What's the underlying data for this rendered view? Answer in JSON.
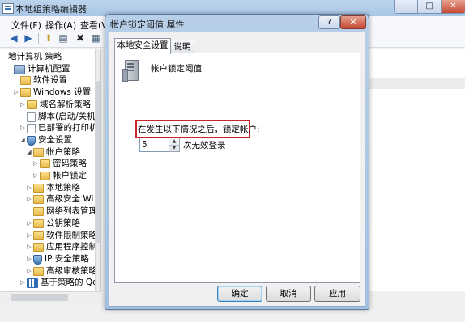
{
  "main_window": {
    "title": "本地组策略编辑器",
    "menu": [
      "文件(F)",
      "操作(A)",
      "查看(V)"
    ],
    "caption": {
      "minimize": "–",
      "maximize": "□",
      "close": "✕"
    }
  },
  "toolbar": {
    "back_icon": "back-arrow-icon",
    "forward_icon": "forward-arrow-icon",
    "back": "◀",
    "forward": "▶",
    "up": "⬆",
    "show_hide": "▤",
    "delete": "✖",
    "properties": "▦"
  },
  "tree": {
    "items": [
      {
        "label": "地计算机 策略",
        "expander": "",
        "icon": "none"
      },
      {
        "label": "计算机配置",
        "expander": "",
        "icon": "pc"
      },
      {
        "label": "软件设置",
        "expander": "",
        "icon": "folder"
      },
      {
        "label": "Windows 设置",
        "expander": "▷",
        "icon": "folder"
      },
      {
        "label": "域名解析策略",
        "expander": "▷",
        "icon": "folder"
      },
      {
        "label": "脚本(启动/关机)",
        "expander": "",
        "icon": "doc"
      },
      {
        "label": "已部署的打印机",
        "expander": "▷",
        "icon": "doc"
      },
      {
        "label": "安全设置",
        "expander": "◢",
        "icon": "shield"
      },
      {
        "label": "帐户策略",
        "expander": "◢",
        "icon": "folder"
      },
      {
        "label": "密码策略",
        "expander": "▷",
        "icon": "folder"
      },
      {
        "label": "帐户锁定",
        "expander": "▷",
        "icon": "folder"
      },
      {
        "label": "本地策略",
        "expander": "▷",
        "icon": "folder"
      },
      {
        "label": "高级安全 Wi",
        "expander": "▷",
        "icon": "folder"
      },
      {
        "label": "网络列表管理",
        "expander": "",
        "icon": "folder"
      },
      {
        "label": "公钥策略",
        "expander": "▷",
        "icon": "folder"
      },
      {
        "label": "软件限制策略",
        "expander": "▷",
        "icon": "folder"
      },
      {
        "label": "应用程序控制",
        "expander": "▷",
        "icon": "folder"
      },
      {
        "label": "IP 安全策略",
        "expander": "▷",
        "icon": "shield"
      },
      {
        "label": "高级审核策略",
        "expander": "▷",
        "icon": "folder"
      },
      {
        "label": "基于策略的 QoS",
        "expander": "▷",
        "icon": "chart"
      }
    ]
  },
  "dialog": {
    "title": "帐户锁定阈值 属性",
    "help": "?",
    "close": "✕",
    "tabs": [
      "本地安全设置",
      "说明"
    ],
    "policy_name": "帐户锁定阈值",
    "lockout_label": "在发生以下情况之后，锁定帐户:",
    "threshold_value": "5",
    "spin_up": "▲",
    "spin_down": "▼",
    "unit_label": "次无效登录",
    "buttons": {
      "ok": "确定",
      "cancel": "取消",
      "apply": "应用"
    },
    "highlight_color": "#c9242a"
  }
}
